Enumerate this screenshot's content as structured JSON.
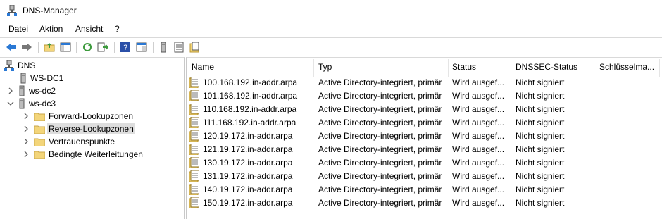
{
  "window": {
    "title": "DNS-Manager"
  },
  "menu": [
    "Datei",
    "Aktion",
    "Ansicht",
    "?"
  ],
  "toolbar": {
    "buttons": [
      "back-icon",
      "forward-icon",
      "up-folder-icon",
      "console-tree-icon",
      "refresh-icon",
      "export-list-icon",
      "help-icon",
      "details-pane-icon",
      "server-icon",
      "list-view-icon",
      "properties-icon"
    ]
  },
  "tree": {
    "root": "DNS",
    "servers": [
      {
        "name": "WS-DC1",
        "state": "none"
      },
      {
        "name": "ws-dc2",
        "state": "collapsed"
      },
      {
        "name": "ws-dc3",
        "state": "expanded"
      }
    ],
    "folders": [
      "Forward-Lookupzonen",
      "Reverse-Lookupzonen",
      "Vertrauenspunkte",
      "Bedingte Weiterleitungen"
    ],
    "selected_folder": "Reverse-Lookupzonen"
  },
  "columns": [
    "Name",
    "Typ",
    "Status",
    "DNSSEC-Status",
    "Schlüsselma..."
  ],
  "rows": [
    {
      "name": "100.168.192.in-addr.arpa",
      "typ": "Active Directory-integriert, primär",
      "status": "Wird ausgef...",
      "dnssec": "Nicht signiert"
    },
    {
      "name": "101.168.192.in-addr.arpa",
      "typ": "Active Directory-integriert, primär",
      "status": "Wird ausgef...",
      "dnssec": "Nicht signiert"
    },
    {
      "name": "110.168.192.in-addr.arpa",
      "typ": "Active Directory-integriert, primär",
      "status": "Wird ausgef...",
      "dnssec": "Nicht signiert"
    },
    {
      "name": "111.168.192.in-addr.arpa",
      "typ": "Active Directory-integriert, primär",
      "status": "Wird ausgef...",
      "dnssec": "Nicht signiert"
    },
    {
      "name": "120.19.172.in-addr.arpa",
      "typ": "Active Directory-integriert, primär",
      "status": "Wird ausgef...",
      "dnssec": "Nicht signiert"
    },
    {
      "name": "121.19.172.in-addr.arpa",
      "typ": "Active Directory-integriert, primär",
      "status": "Wird ausgef...",
      "dnssec": "Nicht signiert"
    },
    {
      "name": "130.19.172.in-addr.arpa",
      "typ": "Active Directory-integriert, primär",
      "status": "Wird ausgef...",
      "dnssec": "Nicht signiert"
    },
    {
      "name": "131.19.172.in-addr.arpa",
      "typ": "Active Directory-integriert, primär",
      "status": "Wird ausgef...",
      "dnssec": "Nicht signiert"
    },
    {
      "name": "140.19.172.in-addr.arpa",
      "typ": "Active Directory-integriert, primär",
      "status": "Wird ausgef...",
      "dnssec": "Nicht signiert"
    },
    {
      "name": "150.19.172.in-addr.arpa",
      "typ": "Active Directory-integriert, primär",
      "status": "Wird ausgef...",
      "dnssec": "Nicht signiert"
    }
  ],
  "colors": {
    "folder": "#f3d57a",
    "selection": "#dedede",
    "arrow_blue": "#2a78d4",
    "arrow_green": "#3c9a3c"
  }
}
